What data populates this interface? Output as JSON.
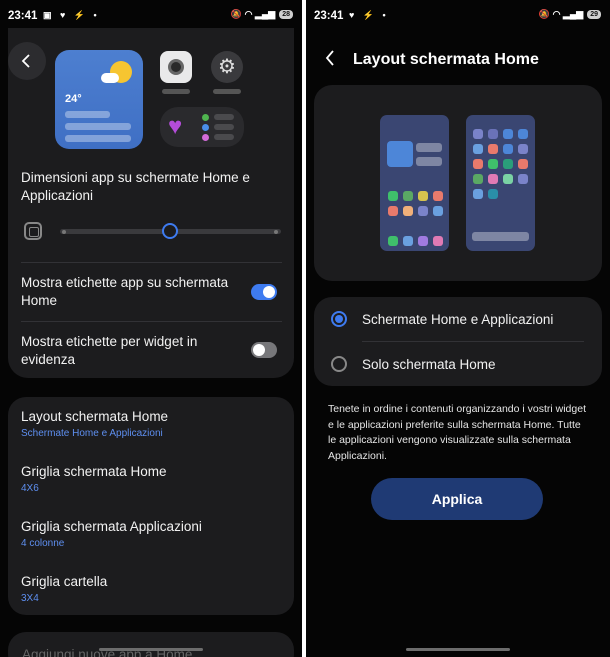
{
  "left": {
    "status": {
      "time": "23:41",
      "icons": "▣ ♥ ⚡ •",
      "right_icons": "🔕 ◠ ▂▄▆",
      "battery": "28"
    },
    "preview": {
      "weather_temp": "24°"
    },
    "size_section": {
      "title": "Dimensioni app su schermate Home e Applicazioni"
    },
    "toggles": [
      {
        "label": "Mostra etichette app su schermata Home",
        "state": "on"
      },
      {
        "label": "Mostra etichette per widget in evidenza",
        "state": "off"
      }
    ],
    "menu": [
      {
        "title": "Layout schermata Home",
        "subtitle": "Schermate Home e Applicazioni"
      },
      {
        "title": "Griglia schermata Home",
        "subtitle": "4X6"
      },
      {
        "title": "Griglia schermata Applicazioni",
        "subtitle": "4 colonne"
      },
      {
        "title": "Griglia cartella",
        "subtitle": "3X4"
      }
    ],
    "peek": {
      "text": "Aggiungi nuove app a Home"
    }
  },
  "right": {
    "status": {
      "time": "23:41",
      "icons": "♥ ⚡ •",
      "right_icons": "🔕 ◠ ▂▄▆",
      "battery": "29"
    },
    "header": {
      "title": "Layout schermata Home"
    },
    "options": [
      {
        "label": "Schermate Home e Applicazioni",
        "selected": true
      },
      {
        "label": "Solo schermata Home",
        "selected": false
      }
    ],
    "description": "Tenete in ordine i contenuti organizzando i vostri widget e le applicazioni preferite sulla schermata Home. Tutte le applicazioni vengono visualizzate sulla schermata Applicazioni.",
    "apply_label": "Applica"
  },
  "colors": {
    "accent": "#3e7bf0",
    "card": "#1c1c1e",
    "background": "#050505",
    "subtitle": "#5e8ff0",
    "apply_button": "#1f3a74"
  }
}
